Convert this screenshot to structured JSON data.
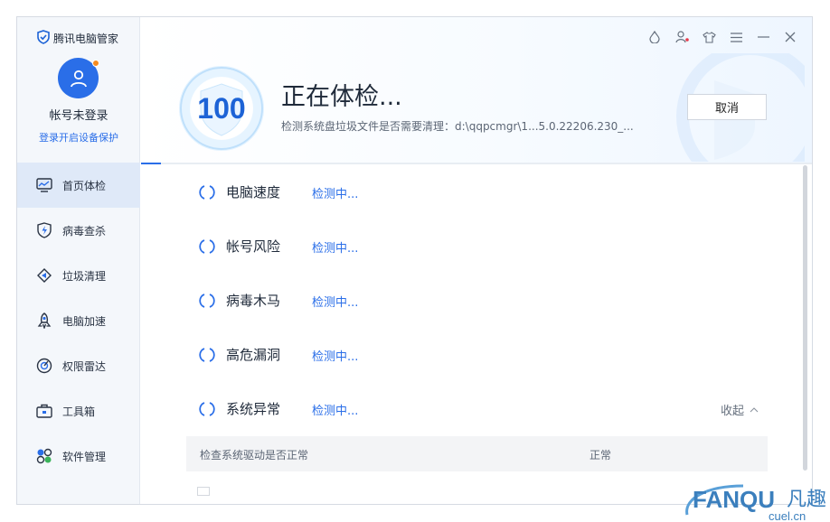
{
  "app": {
    "title": "腾讯电脑管家"
  },
  "user": {
    "name": "帐号未登录",
    "login_link": "登录开启设备保护"
  },
  "nav": [
    {
      "label": "首页体检",
      "icon": "monitor-icon",
      "active": true
    },
    {
      "label": "病毒查杀",
      "icon": "shield-bolt-icon"
    },
    {
      "label": "垃圾清理",
      "icon": "broom-icon"
    },
    {
      "label": "电脑加速",
      "icon": "rocket-icon"
    },
    {
      "label": "权限雷达",
      "icon": "radar-icon"
    },
    {
      "label": "工具箱",
      "icon": "toolbox-icon"
    },
    {
      "label": "软件管理",
      "icon": "apps-icon"
    }
  ],
  "header": {
    "score": "100",
    "title": "正在体检...",
    "subtitle": "检测系统盘垃圾文件是否需要清理：d:\\qqpcmgr\\1...5.0.22206.230_...",
    "cancel_label": "取消",
    "progress": 0.03
  },
  "window_controls": [
    "skin-drop-icon",
    "user-notify-icon",
    "shirt-icon",
    "menu-icon",
    "minimize-icon",
    "close-icon"
  ],
  "checks": [
    {
      "label": "电脑速度",
      "status": "检测中..."
    },
    {
      "label": "帐号风险",
      "status": "检测中..."
    },
    {
      "label": "病毒木马",
      "status": "检测中..."
    },
    {
      "label": "高危漏洞",
      "status": "检测中..."
    },
    {
      "label": "系统异常",
      "status": "检测中..."
    }
  ],
  "collapse_label": "收起",
  "detail": {
    "name": "检查系统驱动是否正常",
    "status": "正常"
  },
  "colors": {
    "accent": "#2a6ee8",
    "sidebar_active": "#dfe9f8"
  },
  "watermark": {
    "brand": "FANQU",
    "cn": "凡趣",
    "domain": "cuel.cn"
  }
}
